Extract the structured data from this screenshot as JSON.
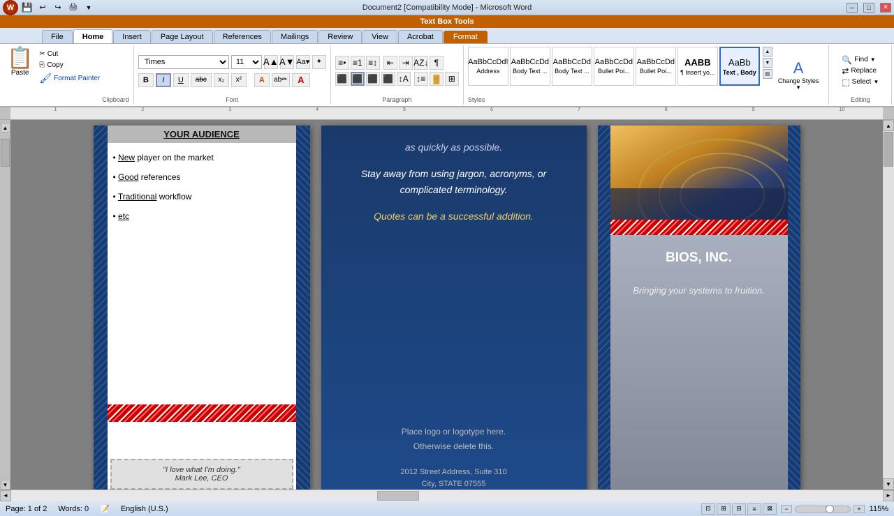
{
  "titlebar": {
    "title": "Document2 [Compatibility Mode] - Microsoft Word",
    "min": "─",
    "max": "□",
    "close": "✕"
  },
  "quickaccess": {
    "save": "💾",
    "undo": "↩",
    "redo": "↪",
    "print": "🖨"
  },
  "textboxtoolsbar": {
    "label": "Text Box Tools"
  },
  "tabs": [
    {
      "label": "File",
      "active": false
    },
    {
      "label": "Home",
      "active": true
    },
    {
      "label": "Insert",
      "active": false
    },
    {
      "label": "Page Layout",
      "active": false
    },
    {
      "label": "References",
      "active": false
    },
    {
      "label": "Mailings",
      "active": false
    },
    {
      "label": "Review",
      "active": false
    },
    {
      "label": "View",
      "active": false
    },
    {
      "label": "Acrobat",
      "active": false
    },
    {
      "label": "Format",
      "active": false
    }
  ],
  "ribbon": {
    "clipboard": {
      "label": "Clipboard",
      "paste": "Paste",
      "cut": "Cut",
      "copy": "Copy",
      "format_painter": "Format Painter"
    },
    "font": {
      "label": "Font",
      "font_name": "Times",
      "font_size": "11",
      "bold": "B",
      "italic": "I",
      "underline": "U",
      "strikethrough": "abc",
      "subscript": "x₂",
      "superscript": "x²"
    },
    "paragraph": {
      "label": "Paragraph"
    },
    "styles": {
      "label": "Styles",
      "items": [
        {
          "name": "Address",
          "preview": "AaBbCcDd"
        },
        {
          "name": "Body Text ...",
          "preview": "AaBbCcDd"
        },
        {
          "name": "Body Text ...",
          "preview": "AaBbCcDd"
        },
        {
          "name": "Bullet Poi...",
          "preview": "AaBbCcDd"
        },
        {
          "name": "Bullet Poi...",
          "preview": "AaBbCc"
        },
        {
          "name": "¶ Insert yo...",
          "preview": "AABB"
        },
        {
          "name": "Text , Body",
          "preview": "AaBb"
        }
      ],
      "change_styles": "Change Styles"
    },
    "editing": {
      "label": "Editing",
      "find": "Find",
      "replace": "Replace",
      "select": "Select"
    }
  },
  "panel1": {
    "title": "YOUR AUDIENCE",
    "bullets": [
      "·  New player on the market",
      "·  Good references",
      "·  Traditional workflow",
      "·  etc"
    ],
    "quote": "\"I love what I'm doing.\" Mark Lee, CEO"
  },
  "panel2": {
    "text1": "as quickly as possible.",
    "text2": "Stay away from using jargon, acronyms, or complicated terminology.",
    "text3": "Quotes can be a successful addition.",
    "logo_text": "Place logo  or logotype here.\nOtherwise delete this.",
    "address1": "2012 Street Address,  Suite 310",
    "address2": "City, STATE 07555"
  },
  "panel3": {
    "company": "BIOS, INC.",
    "tagline": "Bringing your systems to fruition."
  },
  "statusbar": {
    "page": "Page: 1 of 2",
    "words": "Words: 0",
    "language": "English (U.S.)",
    "zoom": "115%"
  }
}
